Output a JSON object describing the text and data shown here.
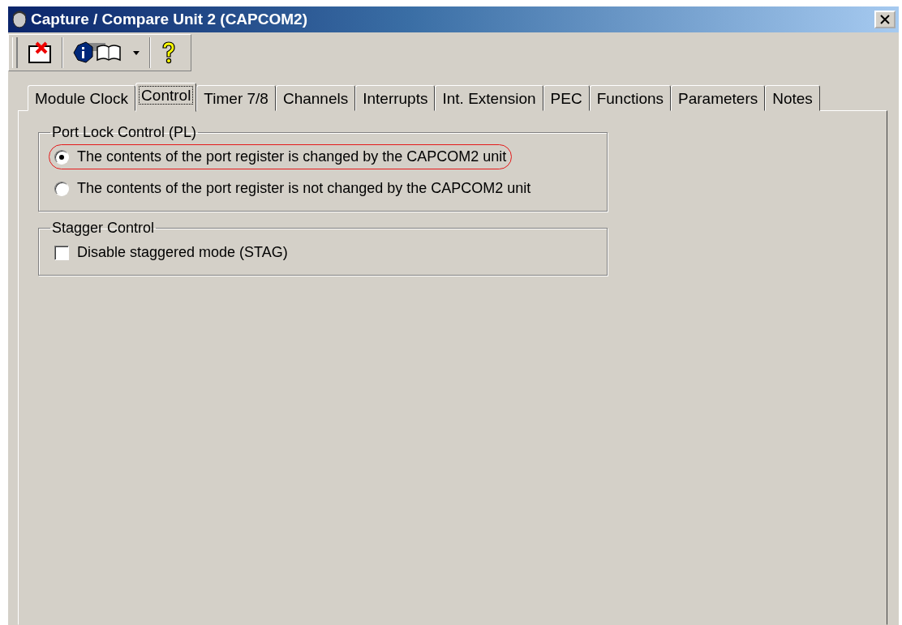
{
  "window": {
    "title": "Capture / Compare Unit 2 (CAPCOM2)"
  },
  "tabs": [
    {
      "label": "Module Clock",
      "selected": false
    },
    {
      "label": "Control",
      "selected": true
    },
    {
      "label": "Timer 7/8",
      "selected": false
    },
    {
      "label": "Channels",
      "selected": false
    },
    {
      "label": "Interrupts",
      "selected": false
    },
    {
      "label": "Int. Extension",
      "selected": false
    },
    {
      "label": "PEC",
      "selected": false
    },
    {
      "label": "Functions",
      "selected": false
    },
    {
      "label": "Parameters",
      "selected": false
    },
    {
      "label": "Notes",
      "selected": false
    }
  ],
  "groups": [
    {
      "title": "Port Lock Control (PL)",
      "items": [
        {
          "kind": "radio",
          "label": "The contents of the port register is changed by the CAPCOM2 unit",
          "selected": true,
          "highlighted": true
        },
        {
          "kind": "radio",
          "label": "The contents of the port register is not changed by the CAPCOM2 unit",
          "selected": false,
          "highlighted": false
        }
      ]
    },
    {
      "title": "Stagger Control",
      "items": [
        {
          "kind": "checkbox",
          "label": "Disable staggered mode (STAG)",
          "checked": false,
          "highlighted": false
        }
      ]
    }
  ]
}
